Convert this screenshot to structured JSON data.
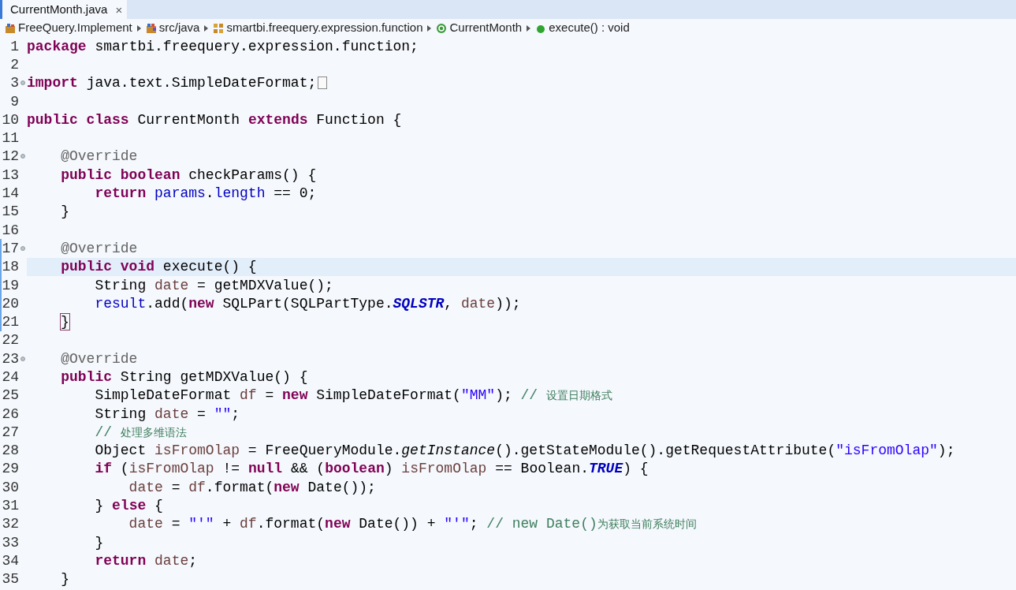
{
  "tab": {
    "title": "CurrentMonth.java",
    "close": "×",
    "selected": true
  },
  "breadcrumb": [
    {
      "label": "FreeQuery.Implement",
      "kind": "project"
    },
    {
      "label": "src/java",
      "kind": "folder"
    },
    {
      "label": "smartbi.freequery.expression.function",
      "kind": "package"
    },
    {
      "label": "CurrentMonth",
      "kind": "class"
    },
    {
      "label": "execute() : void",
      "kind": "method"
    }
  ],
  "lines": [
    {
      "number": "1",
      "fold": false,
      "folded": false,
      "current": false,
      "changed": false,
      "tokens": [
        {
          "kind": "k",
          "text": "package "
        },
        {
          "kind": "p",
          "text": "smartbi.freequery.expression.function;"
        }
      ]
    },
    {
      "number": "2",
      "fold": false,
      "folded": false,
      "current": false,
      "changed": false
    },
    {
      "number": "3",
      "fold": true,
      "folded": true,
      "current": false,
      "changed": false,
      "tokens": [
        {
          "kind": "k",
          "text": "import "
        },
        {
          "kind": "p",
          "text": "java.text.SimpleDateFormat;"
        }
      ]
    },
    {
      "number": "9",
      "fold": false,
      "folded": false,
      "current": false,
      "changed": false
    },
    {
      "number": "10",
      "fold": false,
      "folded": false,
      "current": false,
      "changed": false,
      "tokens": [
        {
          "kind": "k",
          "text": "public class "
        },
        {
          "kind": "p",
          "text": "CurrentMonth "
        },
        {
          "kind": "k",
          "text": "extends "
        },
        {
          "kind": "p",
          "text": "Function {"
        }
      ]
    },
    {
      "number": "11",
      "fold": false,
      "folded": false,
      "current": false,
      "changed": false
    },
    {
      "number": "12",
      "fold": true,
      "folded": false,
      "current": false,
      "changed": false,
      "tokens": [
        {
          "kind": "a",
          "text": "    @Override"
        }
      ]
    },
    {
      "number": "13",
      "fold": false,
      "folded": false,
      "current": false,
      "changed": false,
      "tokens": [
        {
          "kind": "k",
          "text": "    public boolean "
        },
        {
          "kind": "p",
          "text": "checkParams() {"
        }
      ]
    },
    {
      "number": "14",
      "fold": false,
      "folded": false,
      "current": false,
      "changed": false,
      "tokens": [
        {
          "kind": "k",
          "text": "        return "
        },
        {
          "kind": "f",
          "text": "params"
        },
        {
          "kind": "p",
          "text": "."
        },
        {
          "kind": "f",
          "text": "length"
        },
        {
          "kind": "p",
          "text": " == 0;"
        }
      ]
    },
    {
      "number": "15",
      "fold": false,
      "folded": false,
      "current": false,
      "changed": false,
      "tokens": [
        {
          "kind": "p",
          "text": "    }"
        }
      ]
    },
    {
      "number": "16",
      "fold": false,
      "folded": false,
      "current": false,
      "changed": false
    },
    {
      "number": "17",
      "fold": true,
      "folded": false,
      "current": false,
      "changed": true,
      "tokens": [
        {
          "kind": "a",
          "text": "    @Override"
        }
      ]
    },
    {
      "number": "18",
      "fold": false,
      "folded": false,
      "current": true,
      "changed": true,
      "tokens": [
        {
          "kind": "k",
          "text": "    public void "
        },
        {
          "kind": "p",
          "text": "execute() {"
        }
      ]
    },
    {
      "number": "19",
      "fold": false,
      "folded": false,
      "current": false,
      "changed": true,
      "tokens": [
        {
          "kind": "p",
          "text": "        String "
        },
        {
          "kind": "v",
          "text": "date"
        },
        {
          "kind": "p",
          "text": " = getMDXValue();"
        }
      ]
    },
    {
      "number": "20",
      "fold": false,
      "folded": false,
      "current": false,
      "changed": true,
      "tokens": [
        {
          "kind": "f",
          "text": "        result"
        },
        {
          "kind": "p",
          "text": ".add("
        },
        {
          "kind": "k",
          "text": "new"
        },
        {
          "kind": "p",
          "text": " SQLPart(SQLPartType."
        },
        {
          "kind": "si",
          "text": "SQLSTR"
        },
        {
          "kind": "p",
          "text": ", "
        },
        {
          "kind": "v",
          "text": "date"
        },
        {
          "kind": "p",
          "text": "));"
        }
      ]
    },
    {
      "number": "21",
      "fold": false,
      "folded": false,
      "current": false,
      "changed": true,
      "tokens": [
        {
          "kind": "m",
          "text": "}"
        }
      ]
    },
    {
      "number": "22",
      "fold": false,
      "folded": false,
      "current": false,
      "changed": false
    },
    {
      "number": "23",
      "fold": true,
      "folded": false,
      "current": false,
      "changed": false,
      "tokens": [
        {
          "kind": "a",
          "text": "    @Override"
        }
      ]
    },
    {
      "number": "24",
      "fold": false,
      "folded": false,
      "current": false,
      "changed": false,
      "tokens": [
        {
          "kind": "k",
          "text": "    public "
        },
        {
          "kind": "p",
          "text": "String getMDXValue() {"
        }
      ]
    },
    {
      "number": "25",
      "fold": false,
      "folded": false,
      "current": false,
      "changed": false,
      "tokens": [
        {
          "kind": "p",
          "text": "        SimpleDateFormat "
        },
        {
          "kind": "v",
          "text": "df"
        },
        {
          "kind": "p",
          "text": " = "
        },
        {
          "kind": "k",
          "text": "new"
        },
        {
          "kind": "p",
          "text": " SimpleDateFormat("
        },
        {
          "kind": "s",
          "text": "\"MM\""
        },
        {
          "kind": "p",
          "text": "); "
        },
        {
          "kind": "c",
          "text": "// "
        },
        {
          "kind": "cj",
          "text": "设置日期格式"
        }
      ]
    },
    {
      "number": "26",
      "fold": false,
      "folded": false,
      "current": false,
      "changed": false,
      "tokens": [
        {
          "kind": "p",
          "text": "        String "
        },
        {
          "kind": "v",
          "text": "date"
        },
        {
          "kind": "p",
          "text": " = "
        },
        {
          "kind": "s",
          "text": "\"\""
        },
        {
          "kind": "p",
          "text": ";"
        }
      ]
    },
    {
      "number": "27",
      "fold": false,
      "folded": false,
      "current": false,
      "changed": false,
      "tokens": [
        {
          "kind": "c",
          "text": "        // "
        },
        {
          "kind": "cj",
          "text": "处理多维语法"
        }
      ]
    },
    {
      "number": "28",
      "fold": false,
      "folded": false,
      "current": false,
      "changed": false,
      "tokens": [
        {
          "kind": "p",
          "text": "        Object "
        },
        {
          "kind": "v",
          "text": "isFromOlap"
        },
        {
          "kind": "p",
          "text": " = FreeQueryModule."
        },
        {
          "kind": "mi",
          "text": "getInstance"
        },
        {
          "kind": "p",
          "text": "().getStateModule().getRequestAttribute("
        },
        {
          "kind": "s",
          "text": "\"isFromOlap\""
        },
        {
          "kind": "p",
          "text": ");"
        }
      ]
    },
    {
      "number": "29",
      "fold": false,
      "folded": false,
      "current": false,
      "changed": false,
      "tokens": [
        {
          "kind": "k",
          "text": "        if"
        },
        {
          "kind": "p",
          "text": " ("
        },
        {
          "kind": "v",
          "text": "isFromOlap"
        },
        {
          "kind": "p",
          "text": " != "
        },
        {
          "kind": "k",
          "text": "null"
        },
        {
          "kind": "p",
          "text": " && ("
        },
        {
          "kind": "k",
          "text": "boolean"
        },
        {
          "kind": "p",
          "text": ") "
        },
        {
          "kind": "v",
          "text": "isFromOlap"
        },
        {
          "kind": "p",
          "text": " == Boolean."
        },
        {
          "kind": "si",
          "text": "TRUE"
        },
        {
          "kind": "p",
          "text": ") {"
        }
      ]
    },
    {
      "number": "30",
      "fold": false,
      "folded": false,
      "current": false,
      "changed": false,
      "tokens": [
        {
          "kind": "v",
          "text": "            date"
        },
        {
          "kind": "p",
          "text": " = "
        },
        {
          "kind": "v",
          "text": "df"
        },
        {
          "kind": "p",
          "text": ".format("
        },
        {
          "kind": "k",
          "text": "new"
        },
        {
          "kind": "p",
          "text": " Date());"
        }
      ]
    },
    {
      "number": "31",
      "fold": false,
      "folded": false,
      "current": false,
      "changed": false,
      "tokens": [
        {
          "kind": "p",
          "text": "        } "
        },
        {
          "kind": "k",
          "text": "else"
        },
        {
          "kind": "p",
          "text": " {"
        }
      ]
    },
    {
      "number": "32",
      "fold": false,
      "folded": false,
      "current": false,
      "changed": false,
      "tokens": [
        {
          "kind": "v",
          "text": "            date"
        },
        {
          "kind": "p",
          "text": " = "
        },
        {
          "kind": "s",
          "text": "\"'\""
        },
        {
          "kind": "p",
          "text": " + "
        },
        {
          "kind": "v",
          "text": "df"
        },
        {
          "kind": "p",
          "text": ".format("
        },
        {
          "kind": "k",
          "text": "new"
        },
        {
          "kind": "p",
          "text": " Date()) + "
        },
        {
          "kind": "s",
          "text": "\"'\""
        },
        {
          "kind": "p",
          "text": "; "
        },
        {
          "kind": "c",
          "text": "// new Date()"
        },
        {
          "kind": "cj",
          "text": "为获取当前系统时间"
        }
      ]
    },
    {
      "number": "33",
      "fold": false,
      "folded": false,
      "current": false,
      "changed": false,
      "tokens": [
        {
          "kind": "p",
          "text": "        }"
        }
      ]
    },
    {
      "number": "34",
      "fold": false,
      "folded": false,
      "current": false,
      "changed": false,
      "tokens": [
        {
          "kind": "k",
          "text": "        return "
        },
        {
          "kind": "v",
          "text": "date"
        },
        {
          "kind": "p",
          "text": ";"
        }
      ]
    },
    {
      "number": "35",
      "fold": false,
      "folded": false,
      "current": false,
      "changed": false,
      "tokens": [
        {
          "kind": "p",
          "text": "    }"
        }
      ]
    }
  ]
}
